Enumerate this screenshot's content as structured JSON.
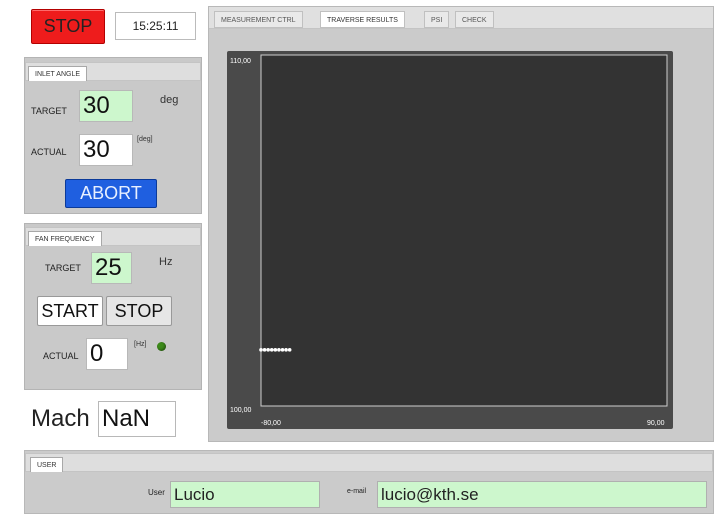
{
  "header": {
    "stop_label": "STOP",
    "clock": "15:25:11"
  },
  "inlet_angle": {
    "tab": "INLET ANGLE",
    "target_label": "TARGET",
    "target_value": "30",
    "target_unit": "deg",
    "actual_label": "ACTUAL",
    "actual_value": "30",
    "actual_unit": "[deg]",
    "abort_label": "ABORT"
  },
  "fan_frequency": {
    "tab": "FAN FREQUENCY",
    "target_label": "TARGET",
    "target_value": "25",
    "target_unit": "Hz",
    "start_label": "START",
    "stop_label": "STOP",
    "actual_label": "ACTUAL",
    "actual_value": "0",
    "actual_unit": "[Hz]",
    "status_color": "#3d8a1a"
  },
  "mach": {
    "label": "Mach",
    "value": "NaN"
  },
  "tabs": [
    {
      "label": "MEASUREMENT CTRL",
      "active": false
    },
    {
      "label": "TRAVERSE RESULTS",
      "active": true
    },
    {
      "label": "PSI",
      "active": false
    },
    {
      "label": "CHECK",
      "active": false
    }
  ],
  "chart_data": {
    "type": "scatter",
    "xlim": [
      -80,
      90
    ],
    "ylim": [
      100,
      110
    ],
    "x_tick_labels": [
      "-80,00",
      "90,00"
    ],
    "y_tick_labels": [
      "110,00",
      "100,00"
    ],
    "grid": false,
    "series": [
      {
        "color": "#ffffff",
        "points": [
          [
            -80,
            101.6
          ],
          [
            -78.5,
            101.6
          ],
          [
            -77,
            101.6
          ],
          [
            -75.5,
            101.6
          ],
          [
            -74,
            101.6
          ],
          [
            -72.5,
            101.6
          ],
          [
            -71,
            101.6
          ],
          [
            -69.5,
            101.6
          ],
          [
            -68,
            101.6
          ]
        ]
      }
    ]
  },
  "user": {
    "tab": "USER",
    "user_label": "User",
    "user_value": "Lucio",
    "email_label": "e-mail",
    "email_value": "lucio@kth.se"
  }
}
